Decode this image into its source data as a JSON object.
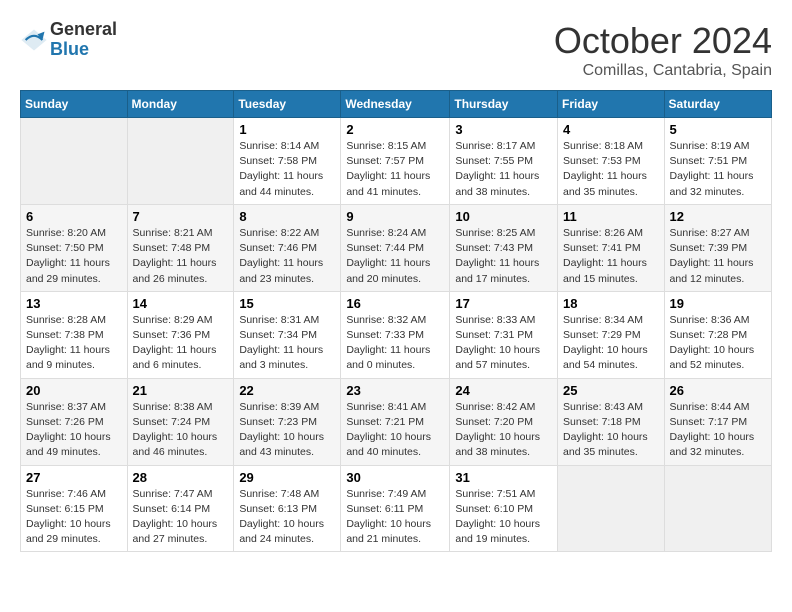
{
  "logo": {
    "general": "General",
    "blue": "Blue"
  },
  "title": "October 2024",
  "subtitle": "Comillas, Cantabria, Spain",
  "days_of_week": [
    "Sunday",
    "Monday",
    "Tuesday",
    "Wednesday",
    "Thursday",
    "Friday",
    "Saturday"
  ],
  "weeks": [
    [
      {
        "day": "",
        "sunrise": "",
        "sunset": "",
        "daylight": ""
      },
      {
        "day": "",
        "sunrise": "",
        "sunset": "",
        "daylight": ""
      },
      {
        "day": "1",
        "sunrise": "Sunrise: 8:14 AM",
        "sunset": "Sunset: 7:58 PM",
        "daylight": "Daylight: 11 hours and 44 minutes."
      },
      {
        "day": "2",
        "sunrise": "Sunrise: 8:15 AM",
        "sunset": "Sunset: 7:57 PM",
        "daylight": "Daylight: 11 hours and 41 minutes."
      },
      {
        "day": "3",
        "sunrise": "Sunrise: 8:17 AM",
        "sunset": "Sunset: 7:55 PM",
        "daylight": "Daylight: 11 hours and 38 minutes."
      },
      {
        "day": "4",
        "sunrise": "Sunrise: 8:18 AM",
        "sunset": "Sunset: 7:53 PM",
        "daylight": "Daylight: 11 hours and 35 minutes."
      },
      {
        "day": "5",
        "sunrise": "Sunrise: 8:19 AM",
        "sunset": "Sunset: 7:51 PM",
        "daylight": "Daylight: 11 hours and 32 minutes."
      }
    ],
    [
      {
        "day": "6",
        "sunrise": "Sunrise: 8:20 AM",
        "sunset": "Sunset: 7:50 PM",
        "daylight": "Daylight: 11 hours and 29 minutes."
      },
      {
        "day": "7",
        "sunrise": "Sunrise: 8:21 AM",
        "sunset": "Sunset: 7:48 PM",
        "daylight": "Daylight: 11 hours and 26 minutes."
      },
      {
        "day": "8",
        "sunrise": "Sunrise: 8:22 AM",
        "sunset": "Sunset: 7:46 PM",
        "daylight": "Daylight: 11 hours and 23 minutes."
      },
      {
        "day": "9",
        "sunrise": "Sunrise: 8:24 AM",
        "sunset": "Sunset: 7:44 PM",
        "daylight": "Daylight: 11 hours and 20 minutes."
      },
      {
        "day": "10",
        "sunrise": "Sunrise: 8:25 AM",
        "sunset": "Sunset: 7:43 PM",
        "daylight": "Daylight: 11 hours and 17 minutes."
      },
      {
        "day": "11",
        "sunrise": "Sunrise: 8:26 AM",
        "sunset": "Sunset: 7:41 PM",
        "daylight": "Daylight: 11 hours and 15 minutes."
      },
      {
        "day": "12",
        "sunrise": "Sunrise: 8:27 AM",
        "sunset": "Sunset: 7:39 PM",
        "daylight": "Daylight: 11 hours and 12 minutes."
      }
    ],
    [
      {
        "day": "13",
        "sunrise": "Sunrise: 8:28 AM",
        "sunset": "Sunset: 7:38 PM",
        "daylight": "Daylight: 11 hours and 9 minutes."
      },
      {
        "day": "14",
        "sunrise": "Sunrise: 8:29 AM",
        "sunset": "Sunset: 7:36 PM",
        "daylight": "Daylight: 11 hours and 6 minutes."
      },
      {
        "day": "15",
        "sunrise": "Sunrise: 8:31 AM",
        "sunset": "Sunset: 7:34 PM",
        "daylight": "Daylight: 11 hours and 3 minutes."
      },
      {
        "day": "16",
        "sunrise": "Sunrise: 8:32 AM",
        "sunset": "Sunset: 7:33 PM",
        "daylight": "Daylight: 11 hours and 0 minutes."
      },
      {
        "day": "17",
        "sunrise": "Sunrise: 8:33 AM",
        "sunset": "Sunset: 7:31 PM",
        "daylight": "Daylight: 10 hours and 57 minutes."
      },
      {
        "day": "18",
        "sunrise": "Sunrise: 8:34 AM",
        "sunset": "Sunset: 7:29 PM",
        "daylight": "Daylight: 10 hours and 54 minutes."
      },
      {
        "day": "19",
        "sunrise": "Sunrise: 8:36 AM",
        "sunset": "Sunset: 7:28 PM",
        "daylight": "Daylight: 10 hours and 52 minutes."
      }
    ],
    [
      {
        "day": "20",
        "sunrise": "Sunrise: 8:37 AM",
        "sunset": "Sunset: 7:26 PM",
        "daylight": "Daylight: 10 hours and 49 minutes."
      },
      {
        "day": "21",
        "sunrise": "Sunrise: 8:38 AM",
        "sunset": "Sunset: 7:24 PM",
        "daylight": "Daylight: 10 hours and 46 minutes."
      },
      {
        "day": "22",
        "sunrise": "Sunrise: 8:39 AM",
        "sunset": "Sunset: 7:23 PM",
        "daylight": "Daylight: 10 hours and 43 minutes."
      },
      {
        "day": "23",
        "sunrise": "Sunrise: 8:41 AM",
        "sunset": "Sunset: 7:21 PM",
        "daylight": "Daylight: 10 hours and 40 minutes."
      },
      {
        "day": "24",
        "sunrise": "Sunrise: 8:42 AM",
        "sunset": "Sunset: 7:20 PM",
        "daylight": "Daylight: 10 hours and 38 minutes."
      },
      {
        "day": "25",
        "sunrise": "Sunrise: 8:43 AM",
        "sunset": "Sunset: 7:18 PM",
        "daylight": "Daylight: 10 hours and 35 minutes."
      },
      {
        "day": "26",
        "sunrise": "Sunrise: 8:44 AM",
        "sunset": "Sunset: 7:17 PM",
        "daylight": "Daylight: 10 hours and 32 minutes."
      }
    ],
    [
      {
        "day": "27",
        "sunrise": "Sunrise: 7:46 AM",
        "sunset": "Sunset: 6:15 PM",
        "daylight": "Daylight: 10 hours and 29 minutes."
      },
      {
        "day": "28",
        "sunrise": "Sunrise: 7:47 AM",
        "sunset": "Sunset: 6:14 PM",
        "daylight": "Daylight: 10 hours and 27 minutes."
      },
      {
        "day": "29",
        "sunrise": "Sunrise: 7:48 AM",
        "sunset": "Sunset: 6:13 PM",
        "daylight": "Daylight: 10 hours and 24 minutes."
      },
      {
        "day": "30",
        "sunrise": "Sunrise: 7:49 AM",
        "sunset": "Sunset: 6:11 PM",
        "daylight": "Daylight: 10 hours and 21 minutes."
      },
      {
        "day": "31",
        "sunrise": "Sunrise: 7:51 AM",
        "sunset": "Sunset: 6:10 PM",
        "daylight": "Daylight: 10 hours and 19 minutes."
      },
      {
        "day": "",
        "sunrise": "",
        "sunset": "",
        "daylight": ""
      },
      {
        "day": "",
        "sunrise": "",
        "sunset": "",
        "daylight": ""
      }
    ]
  ]
}
